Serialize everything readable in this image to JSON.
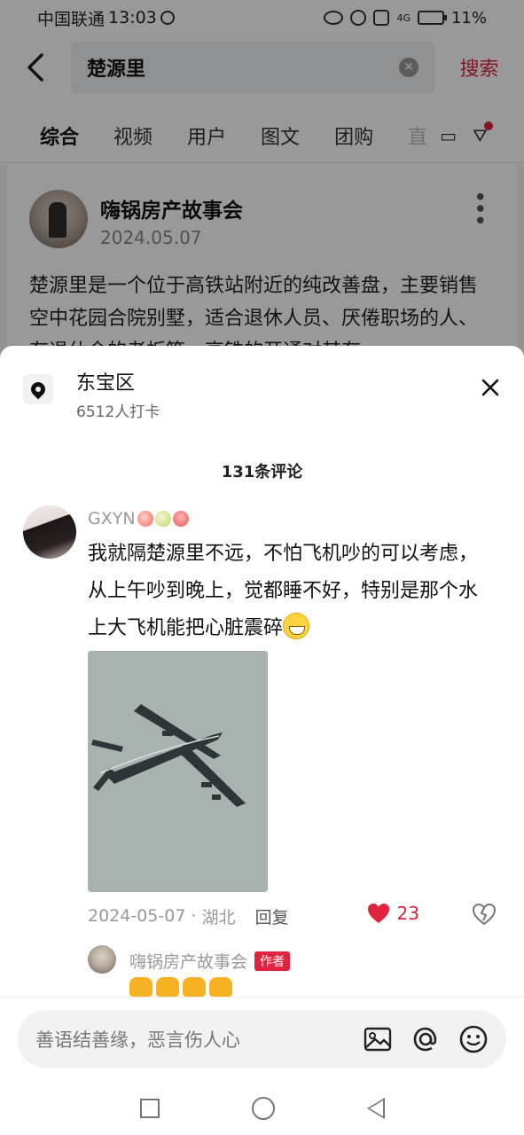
{
  "status_bar": {
    "carrier": "中国联通",
    "time": "13:03",
    "battery": "11%",
    "network": "4G"
  },
  "search": {
    "query": "楚源里",
    "submit_label": "搜索"
  },
  "tabs": [
    {
      "label": "综合",
      "active": true
    },
    {
      "label": "视频"
    },
    {
      "label": "用户"
    },
    {
      "label": "图文"
    },
    {
      "label": "团购"
    },
    {
      "label": "直"
    }
  ],
  "post": {
    "author": "嗨锅房产故事会",
    "date": "2024.05.07",
    "body": "楚源里是一个位于高铁站附近的纯改善盘，主要销售空中花园合院别墅，适合退休人员、厌倦职场的人、有退休金的老板等。高铁的开通对其有"
  },
  "sheet": {
    "location_name": "东宝区",
    "location_checkins": "6512人打卡",
    "comment_count": "131条评论"
  },
  "comment": {
    "username": "GXYN",
    "text": "我就隔楚源里不远，不怕飞机吵的可以考虑，从上午吵到晚上，觉都睡不好，特别是那个水上大飞机能把心脏震碎",
    "date": "2024-05-07",
    "region": "湖北",
    "reply_label": "回复",
    "like_count": "23"
  },
  "reply": {
    "username": "嗨锅房产故事会",
    "badge": "作者"
  },
  "input": {
    "placeholder": "善语结善缘，恶言伤人心"
  },
  "colors": {
    "accent": "#e0243f",
    "dim_overlay": "rgba(0,0,0,0.40)"
  },
  "icons": [
    "back-arrow-icon",
    "clear-icon",
    "filter-icon",
    "location-pin-icon",
    "close-icon",
    "heart-icon",
    "dislike-heart-icon",
    "image-icon",
    "at-icon",
    "emoji-icon"
  ]
}
